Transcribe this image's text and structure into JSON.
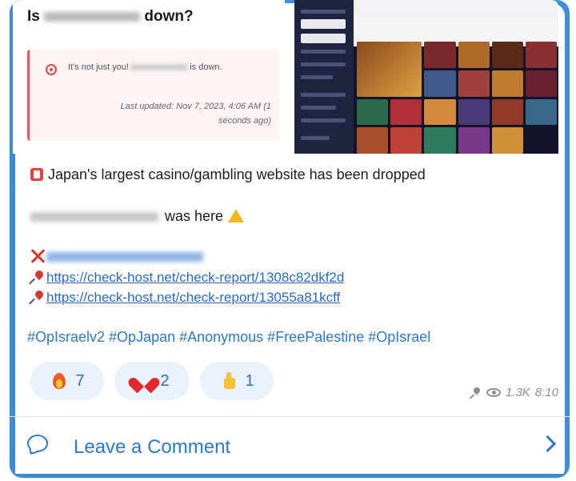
{
  "preview": {
    "title_prefix": "Is",
    "title_suffix": "down?",
    "alert_prefix": "It's not just you!",
    "alert_suffix": "is down.",
    "last_updated": "Last updated: Nov 7, 2023, 4:06 AM (1 seconds ago)"
  },
  "message": {
    "headline": "Japan's largest casino/gambling website has been dropped",
    "signature_suffix": "was here",
    "links": [
      "https://check-host.net/check-report/1308c82dkf2d",
      "https://check-host.net/check-report/13055a81kcff"
    ],
    "hashtags": "#OpIsraelv2 #OpJapan #Anonymous #FreePalestine #OpIsrael"
  },
  "reactions": [
    {
      "emoji": "fire-icon",
      "count": "7"
    },
    {
      "emoji": "heart-icon",
      "count": "2"
    },
    {
      "emoji": "thumbs-up-icon",
      "count": "1"
    }
  ],
  "meta": {
    "views": "1.3K",
    "time": "8:10"
  },
  "comment": {
    "label": "Leave a Comment"
  },
  "colors": {
    "accent": "#3c8ad4",
    "link": "#2a6bbf",
    "reaction_bg": "#e9f1fb"
  }
}
